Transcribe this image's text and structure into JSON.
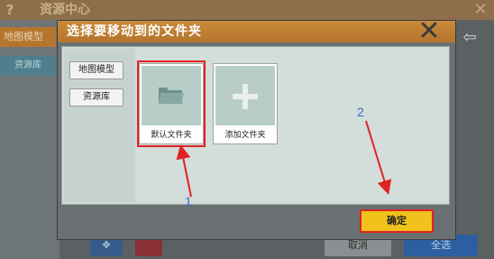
{
  "background": {
    "title": "资源中心",
    "help_icon": "question-icon",
    "sidebar_tabs": [
      "地图模型",
      "资源库"
    ],
    "buttons": {
      "cancel": "取消",
      "select_all": "全选"
    }
  },
  "dialog": {
    "title": "选择要移动到的文件夹",
    "close_icon": "close-x-icon",
    "nav": [
      "地图模型",
      "资源库"
    ],
    "folders": [
      {
        "label": "默认文件夹",
        "icon": "folder-icon",
        "selected": true
      },
      {
        "label": "添加文件夹",
        "icon": "plus-icon",
        "selected": false
      }
    ],
    "confirm_label": "确定"
  },
  "annotations": {
    "marker_1": "1",
    "marker_2": "2"
  },
  "colors": {
    "header": "#c07f33",
    "confirm": "#f0c21b",
    "highlight": "#e02424",
    "arrow": "#e02424",
    "marker": "#3a68c8"
  }
}
